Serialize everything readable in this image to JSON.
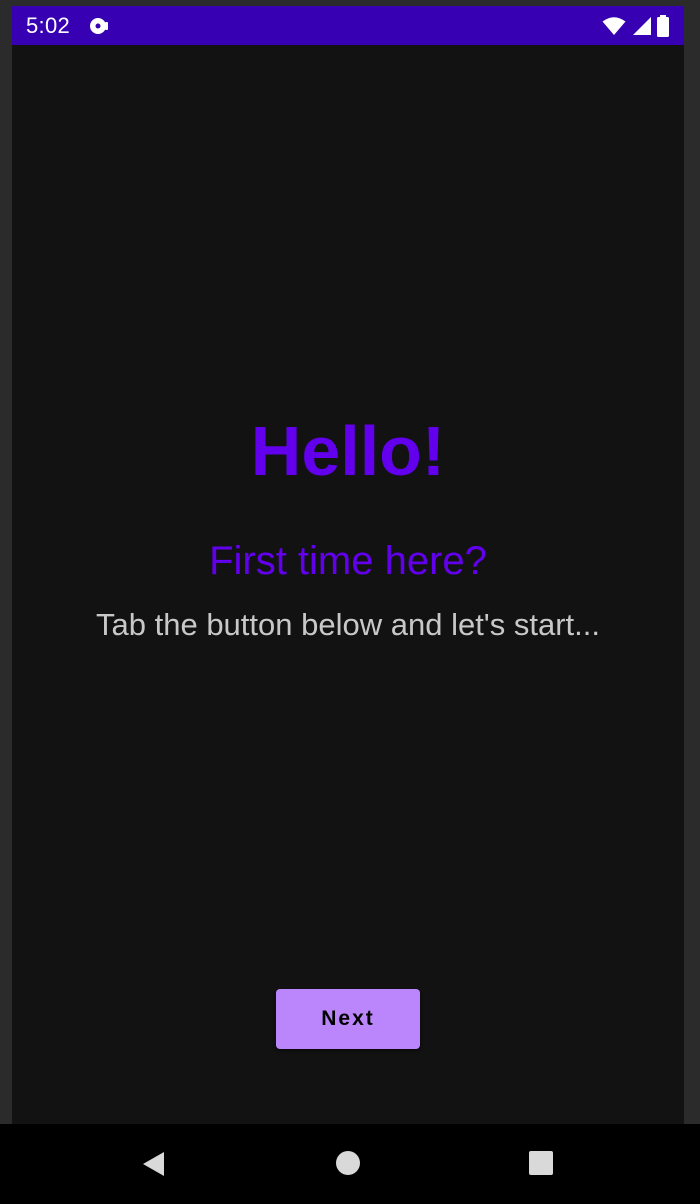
{
  "status_bar": {
    "time": "5:02",
    "notification_icon": "media-disc-icon",
    "icons": [
      "wifi-icon",
      "cell-signal-icon",
      "battery-icon"
    ],
    "background_color": "#3700b3"
  },
  "main": {
    "title": "Hello!",
    "subtitle": "First time here?",
    "tagline": "Tab the button below and let's start...",
    "next_label": "Next",
    "accent_color": "#6200ee",
    "button_color": "#bb86fc",
    "background_color": "#121212"
  },
  "nav_bar": {
    "buttons": [
      "back-icon",
      "home-icon",
      "recents-icon"
    ]
  }
}
